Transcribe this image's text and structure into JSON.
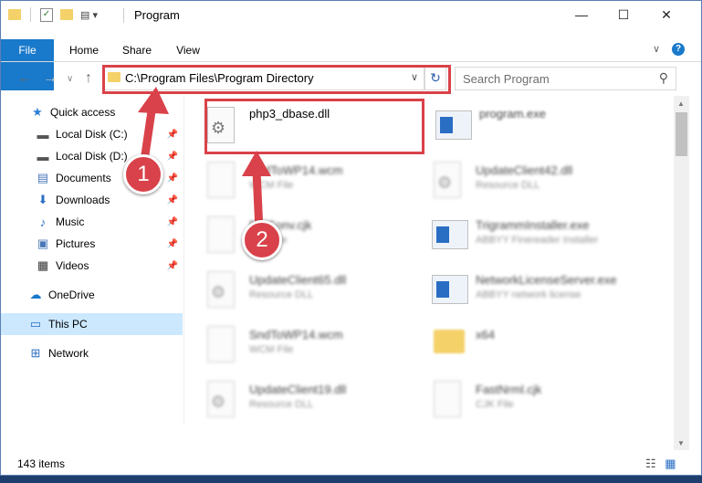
{
  "window": {
    "title": "Program",
    "controls": {
      "minimize": "—",
      "maximize": "☐",
      "close": "✕"
    }
  },
  "ribbon": {
    "tabs": [
      "File",
      "Home",
      "Share",
      "View"
    ]
  },
  "address": {
    "path": "C:\\Program Files\\Program Directory"
  },
  "search": {
    "placeholder": "Search Program"
  },
  "sidebar": {
    "items": [
      {
        "label": "Quick access",
        "icon": "star-icon"
      },
      {
        "label": "Local Disk (C:)",
        "icon": "drive-icon",
        "pinned": true
      },
      {
        "label": "Local Disk (D:)",
        "icon": "drive-icon",
        "pinned": true
      },
      {
        "label": "Documents",
        "icon": "documents-icon",
        "pinned": true
      },
      {
        "label": "Downloads",
        "icon": "download-icon",
        "pinned": true
      },
      {
        "label": "Music",
        "icon": "music-icon",
        "pinned": true
      },
      {
        "label": "Pictures",
        "icon": "pictures-icon",
        "pinned": true
      },
      {
        "label": "Videos",
        "icon": "videos-icon",
        "pinned": true
      },
      {
        "label": "OneDrive",
        "icon": "cloud-icon"
      },
      {
        "label": "This PC",
        "icon": "computer-icon",
        "selected": true
      },
      {
        "label": "Network",
        "icon": "network-icon"
      }
    ]
  },
  "files": [
    {
      "name": "php3_dbase.dll",
      "type": "",
      "kind": "dll",
      "highlighted": true
    },
    {
      "name": "program.exe",
      "type": "",
      "kind": "exe"
    },
    {
      "name": "SndToWP14.wcm",
      "type": "WCM File",
      "kind": "doc"
    },
    {
      "name": "UpdateClient42.dll",
      "type": "Resource DLL",
      "kind": "dll"
    },
    {
      "name": "PdfConv.cjk",
      "type": "CJK File",
      "kind": "doc"
    },
    {
      "name": "TrigrammInstaller.exe",
      "type": "ABBYY Finereader Installer",
      "kind": "exe"
    },
    {
      "name": "UpdateClient65.dll",
      "type": "Resource DLL",
      "kind": "dll"
    },
    {
      "name": "NetworkLicenseServer.exe",
      "type": "ABBYY network license",
      "kind": "exe"
    },
    {
      "name": "SndToWP14.wcm",
      "type": "WCM File",
      "kind": "doc"
    },
    {
      "name": "x64",
      "type": "",
      "kind": "folder"
    },
    {
      "name": "UpdateClient19.dll",
      "type": "Resource DLL",
      "kind": "dll"
    },
    {
      "name": "FastNrml.cjk",
      "type": "CJK File",
      "kind": "doc"
    }
  ],
  "status": {
    "item_count": "143 items"
  },
  "callouts": [
    "1",
    "2"
  ],
  "colors": {
    "accent": "#1979ca",
    "highlight": "#d9424a",
    "selection": "#cce8ff"
  }
}
